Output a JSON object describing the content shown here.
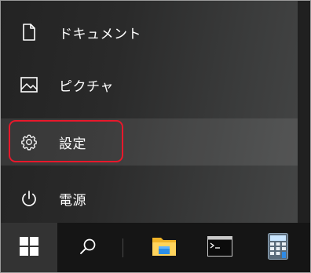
{
  "start_menu": {
    "items": [
      {
        "label": "ドキュメント",
        "icon": "document-icon"
      },
      {
        "label": "ピクチャ",
        "icon": "picture-icon"
      },
      {
        "label": "設定",
        "icon": "gear-icon"
      },
      {
        "label": "電源",
        "icon": "power-icon"
      }
    ]
  },
  "taskbar": {
    "buttons": [
      {
        "icon": "windows-logo-icon"
      },
      {
        "icon": "search-icon"
      },
      {
        "icon": "file-explorer-icon"
      },
      {
        "icon": "command-prompt-icon"
      },
      {
        "icon": "calculator-icon"
      }
    ]
  },
  "colors": {
    "highlight_border": "#e8182b",
    "taskbar_bg": "#151515",
    "start_button_bg": "#333333"
  }
}
